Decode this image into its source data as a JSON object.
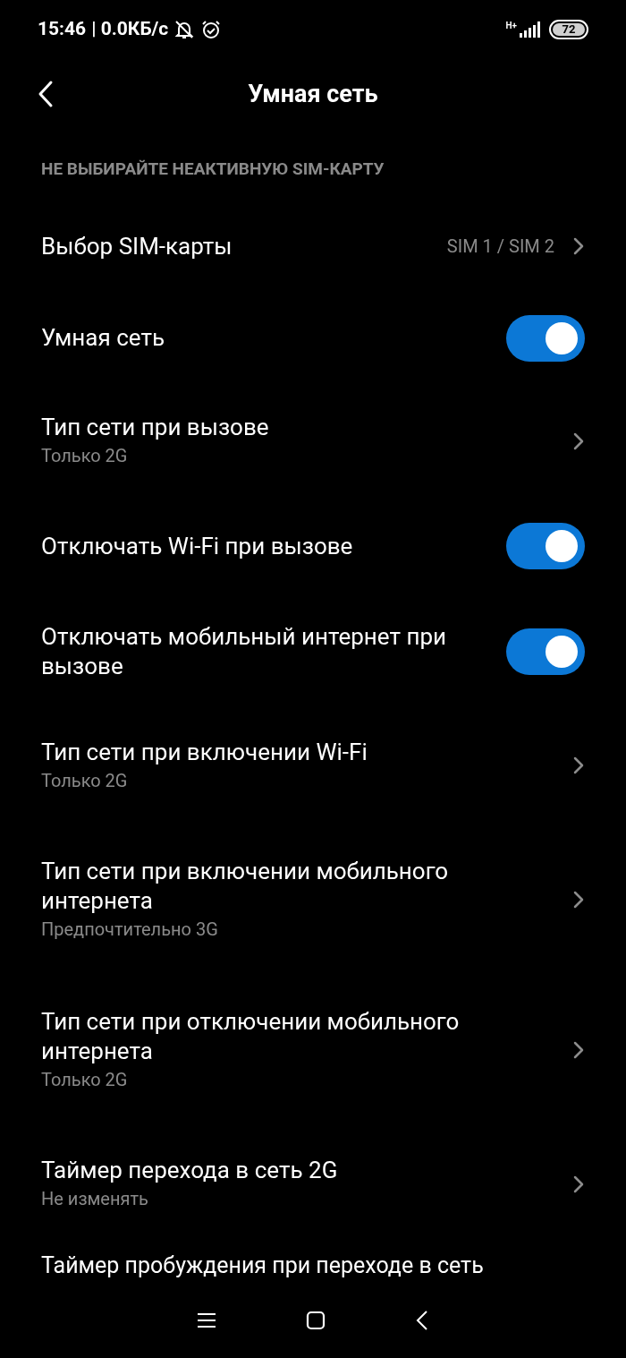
{
  "status_bar": {
    "time": "15:46",
    "speed": "| 0.0КБ/с",
    "network": "H+",
    "battery": "72"
  },
  "header": {
    "title": "Умная сеть"
  },
  "section": {
    "title": "НЕ ВЫБИРАЙТЕ НЕАКТИВНУЮ SIM-КАРТУ"
  },
  "rows": [
    {
      "kind": "link",
      "title": "Выбор SIM-карты",
      "value": "SIM 1 / SIM 2"
    },
    {
      "kind": "toggle",
      "title": "Умная сеть",
      "on": true
    },
    {
      "kind": "link",
      "title": "Тип сети при вызове",
      "subtitle": "Только 2G"
    },
    {
      "kind": "toggle",
      "title": "Отключать Wi-Fi при вызове",
      "on": true
    },
    {
      "kind": "toggle",
      "title": "Отключать мобильный интернет при вызове",
      "on": true
    },
    {
      "kind": "link",
      "title": "Тип сети при включении Wi-Fi",
      "subtitle": "Только 2G"
    },
    {
      "kind": "link",
      "title": "Тип сети при включении мобильного интернета",
      "subtitle": "Предпочтительно 3G"
    },
    {
      "kind": "link",
      "title": "Тип сети при отключении мобильного интернета",
      "subtitle": "Только 2G"
    },
    {
      "kind": "link",
      "title": "Таймер перехода в сеть 2G",
      "subtitle": "Не изменять"
    },
    {
      "kind": "partial",
      "title": "Таймер пробуждения при переходе в сеть"
    }
  ]
}
